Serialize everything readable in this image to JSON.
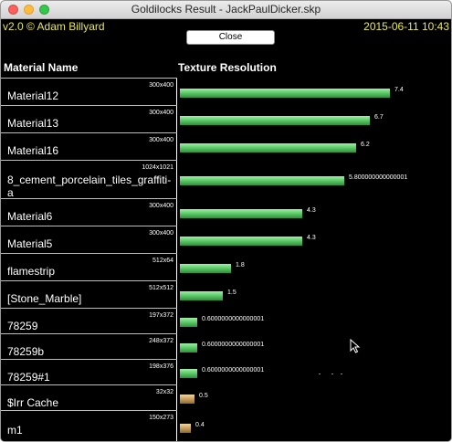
{
  "window": {
    "title": "Goldilocks Result - JackPaulDicker.skp"
  },
  "header": {
    "version": "v2.0 © Adam Billyard",
    "date": "2015-06-11 10:43"
  },
  "toolbar": {
    "close_label": "Close"
  },
  "columns": {
    "material": "Material Name",
    "texture": "Texture Resolution"
  },
  "rows": [
    {
      "name": "Material12",
      "resolution": "300x400",
      "value": "7.4",
      "color": "#5fcc6a"
    },
    {
      "name": "Material13",
      "resolution": "300x400",
      "value": "6.7",
      "color": "#5fcc6a"
    },
    {
      "name": "Material16",
      "resolution": "300x400",
      "value": "6.2",
      "color": "#5fcc6a"
    },
    {
      "name": "8_cement_porcelain_tiles_graffiti-a",
      "resolution": "1024x1021",
      "value": "5.800000000000001",
      "color": "#5fcc6a"
    },
    {
      "name": "Material6",
      "resolution": "300x400",
      "value": "4.3",
      "color": "#5fcc6a"
    },
    {
      "name": "Material5",
      "resolution": "300x400",
      "value": "4.3",
      "color": "#5fcc6a"
    },
    {
      "name": "flamestrip",
      "resolution": "512x64",
      "value": "1.8",
      "color": "#5fcc6a"
    },
    {
      "name": "[Stone_Marble]",
      "resolution": "512x512",
      "value": "1.5",
      "color": "#5fcc6a"
    },
    {
      "name": "78259",
      "resolution": "197x372",
      "value": "0.6000000000000001",
      "color": "#5fcc6a"
    },
    {
      "name": "78259b",
      "resolution": "248x372",
      "value": "0.6000000000000001",
      "color": "#5fcc6a"
    },
    {
      "name": "78259#1",
      "resolution": "198x376",
      "value": "0.6000000000000001",
      "color": "#5fcc6a"
    },
    {
      "name": "$Irr Cache",
      "resolution": "32x32",
      "value": "0.5",
      "color": "#cfa565"
    },
    {
      "name": "m1",
      "resolution": "150x273",
      "value": "0.4",
      "color": "#cfa565"
    }
  ],
  "icons": {
    "cursor": "arrow-cursor-icon"
  }
}
